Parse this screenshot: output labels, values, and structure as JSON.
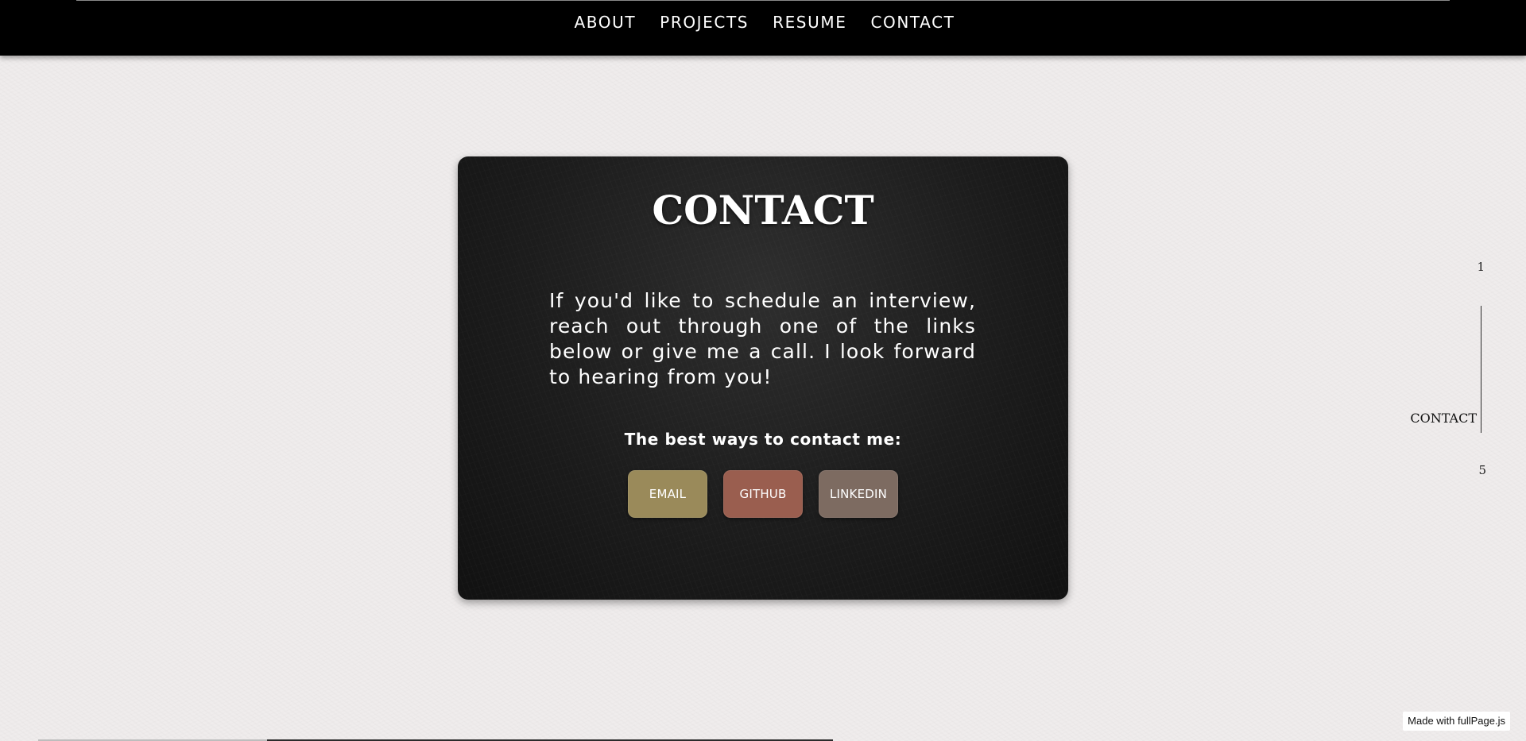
{
  "nav": {
    "links": [
      "ABOUT",
      "PROJECTS",
      "RESUME",
      "CONTACT"
    ]
  },
  "contact": {
    "title": "CONTACT",
    "text": "If you'd like to schedule an interview, reach out through one of the links below or give me a call. I look forward to hearing from you!",
    "subtitle": "The best ways to contact me:",
    "buttons": [
      {
        "label": "EMAIL",
        "color": "#9a8a5a"
      },
      {
        "label": "GITHUB",
        "color": "#9a5e4f"
      },
      {
        "label": "LINKEDIN",
        "color": "#7d6b61"
      }
    ]
  },
  "side_nav": {
    "top_number": "1",
    "active_label": "CONTACT",
    "bottom_number": "5"
  },
  "footer": {
    "badge": "Made with fullPage.js"
  },
  "colors": {
    "nav_bg": "#000000",
    "page_bg": "#efecec",
    "card_bg": "#1c1c1c"
  }
}
